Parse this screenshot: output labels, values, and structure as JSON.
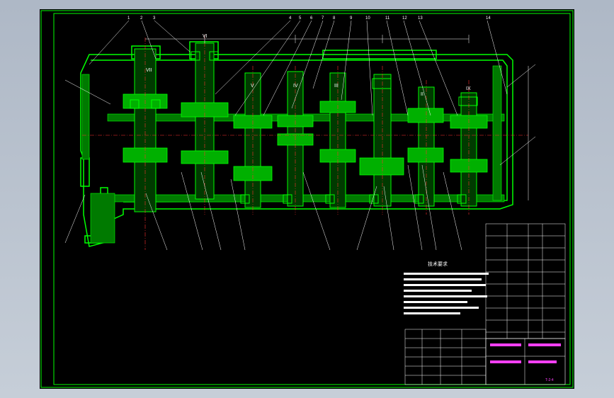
{
  "colors": {
    "background": "#000000",
    "viewport": "#b9c3cf",
    "frame": "#00ff00",
    "housing": "#00ff00",
    "hatch": "#00c000",
    "centerline": "#ff3030",
    "dimension": "#ffffff",
    "annotation": "#ff40ff"
  },
  "shaft_labels": [
    "VII",
    "VI",
    "V",
    "IV",
    "III",
    "II",
    "IX"
  ],
  "technical_requirements_title": "技术要求",
  "drawing_number": "T-2-4"
}
